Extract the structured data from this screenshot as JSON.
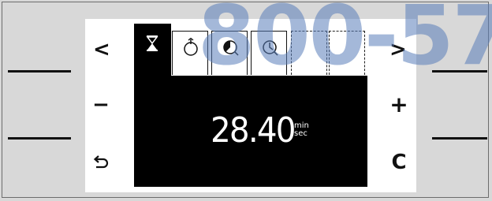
{
  "watermark": "800-57",
  "timer": {
    "value": "28.40",
    "unit_top": "min",
    "unit_bottom": "sec"
  },
  "buttons": {
    "back": "<",
    "forward": ">",
    "minus": "−",
    "plus": "+",
    "clear": "C"
  },
  "tabs": [
    {
      "icon": "hourglass-icon",
      "selected": true
    },
    {
      "icon": "stopwatch-icon",
      "selected": false
    },
    {
      "icon": "end-time-icon",
      "selected": false
    },
    {
      "icon": "clock-icon",
      "selected": false
    },
    {
      "icon": "empty",
      "selected": false
    },
    {
      "icon": "empty",
      "selected": false
    }
  ],
  "colors": {
    "background": "#d8d8d8",
    "panel": "#ffffff",
    "screen": "#000000",
    "watermark": "#5a7db9"
  }
}
